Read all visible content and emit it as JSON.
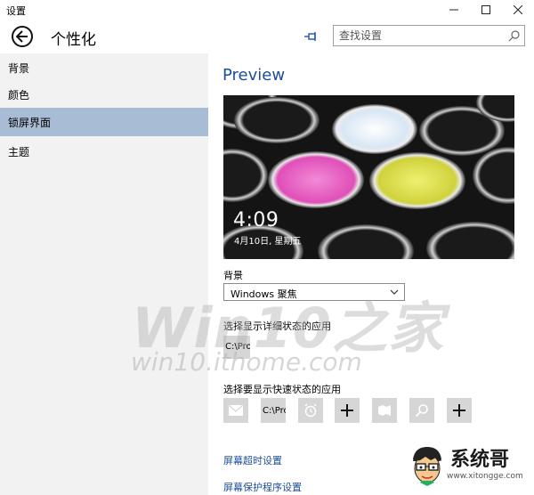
{
  "window": {
    "title": "设置",
    "minimize": "—",
    "maximize": "☐",
    "close": "✕"
  },
  "header": {
    "title": "个性化",
    "search_placeholder": "查找设置"
  },
  "sidebar": {
    "items": [
      {
        "label": "背景",
        "selected": false
      },
      {
        "label": "颜色",
        "selected": false
      },
      {
        "label": "锁屏界面",
        "selected": true
      },
      {
        "label": "主题",
        "selected": false
      }
    ],
    "selected_color": "#a9bcd6"
  },
  "main": {
    "preview_title": "Preview",
    "lock_time": "4:09",
    "lock_date": "4月10日, 星期五",
    "background_label": "背景",
    "background_value": "Windows 聚焦",
    "detail_label": "选择显示详细状态的应用",
    "detail_app": "C:\\Pro",
    "quick_label": "选择要显示快速状态的应用",
    "quick_apps": [
      {
        "icon": "mail-icon",
        "text": ""
      },
      {
        "icon": "",
        "text": "C:\\Pro"
      },
      {
        "icon": "alarm-icon",
        "text": ""
      },
      {
        "icon": "plus-icon",
        "text": ""
      },
      {
        "icon": "store-icon",
        "text": ""
      },
      {
        "icon": "search-icon",
        "text": ""
      },
      {
        "icon": "plus-icon",
        "text": ""
      }
    ],
    "link_timeout": "屏幕超时设置",
    "link_saver": "屏幕保护程序设置"
  },
  "watermark": {
    "big": "Win10之家",
    "url": "win10.ithome.com",
    "logo_text": "系统哥",
    "logo_url": "www.xitongge.com"
  },
  "colors": {
    "accent": "#1f4e99",
    "sidebar_bg": "#f2f2f2",
    "tile_bg": "#d6d6d6"
  }
}
